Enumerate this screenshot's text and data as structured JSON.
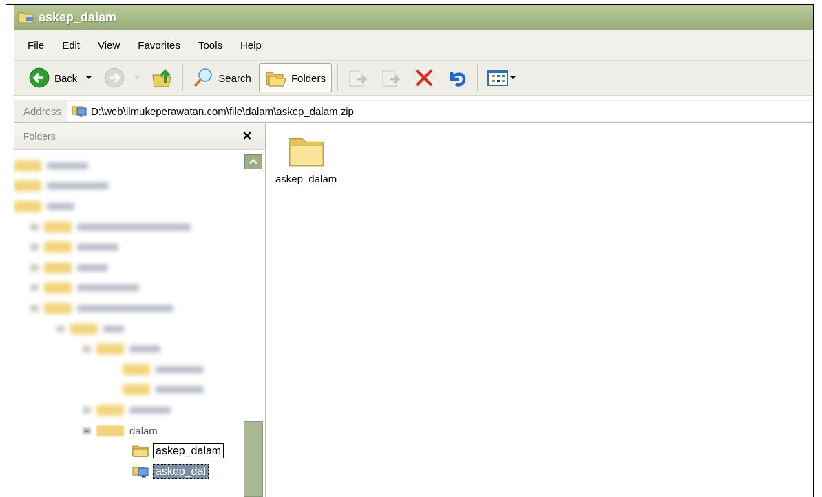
{
  "window": {
    "title": "askep_dalam"
  },
  "menu": [
    "File",
    "Edit",
    "View",
    "Favorites",
    "Tools",
    "Help"
  ],
  "toolbar": [
    {
      "kind": "back",
      "label": "Back",
      "disabled": false
    },
    {
      "kind": "forward",
      "disabled": true
    },
    {
      "kind": "up"
    },
    {
      "kind": "search",
      "label": "Search"
    },
    {
      "kind": "folders",
      "label": "Folders",
      "selected": true
    },
    {
      "kind": "move",
      "disabled": true
    },
    {
      "kind": "copy",
      "disabled": true
    },
    {
      "kind": "delete"
    },
    {
      "kind": "undo"
    },
    {
      "kind": "views"
    }
  ],
  "address": {
    "label": "Address",
    "value": "D:\\web\\ilmukeperawatan.com\\file\\dalam\\askep_dalam.zip"
  },
  "folders_pane": {
    "title": "Folders",
    "tree": [
      {
        "label": "dalam",
        "expanded": true,
        "children": [
          {
            "label": "askep_dalam",
            "kind": "folder",
            "selected": false,
            "tooltip": true
          },
          {
            "label": "askep_dal",
            "kind": "zip",
            "selected": true,
            "tooltip": false
          }
        ]
      }
    ]
  },
  "content": {
    "items": [
      {
        "label": "askep_dalam",
        "kind": "folder"
      }
    ]
  }
}
